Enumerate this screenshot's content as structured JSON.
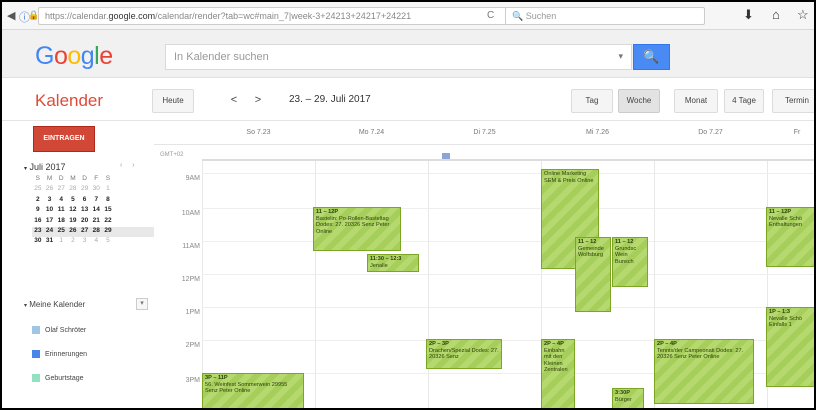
{
  "browser": {
    "url_prefix": "https://calendar.",
    "url_domain": "google.com",
    "url_rest": "/calendar/render?tab=wc#main_7|week-3+24213+24217+24221",
    "search_placeholder": "Suchen",
    "reload_glyph": "C",
    "icons": [
      "back-icon",
      "info-icon",
      "lock-icon",
      "reload-icon",
      "download-icon",
      "home-icon",
      "bookmark-icon"
    ]
  },
  "google": {
    "logo_letters": [
      "G",
      "o",
      "o",
      "g",
      "l",
      "e"
    ],
    "search_placeholder": "In Kalender suchen",
    "search_button_glyph": "🔍"
  },
  "toolbar": {
    "app_title": "Kalender",
    "today": "Heute",
    "prev": "<",
    "next": ">",
    "date_range": "23. – 29. Juli 2017",
    "views": [
      {
        "label": "Tag",
        "active": false
      },
      {
        "label": "Woche",
        "active": true
      },
      {
        "label": "Monat",
        "active": false
      },
      {
        "label": "4 Tage",
        "active": false
      },
      {
        "label": "Termin",
        "active": false
      }
    ]
  },
  "sidebar": {
    "create_button": "EINTRAGEN",
    "mini_title": "Juli 2017",
    "mini_nav": "‹ ›",
    "weekdays": [
      "S",
      "M",
      "D",
      "M",
      "D",
      "F",
      "S"
    ],
    "weeks": [
      [
        "25",
        "26",
        "27",
        "28",
        "29",
        "30",
        "1"
      ],
      [
        "2",
        "3",
        "4",
        "5",
        "6",
        "7",
        "8"
      ],
      [
        "9",
        "10",
        "11",
        "12",
        "13",
        "14",
        "15"
      ],
      [
        "16",
        "17",
        "18",
        "19",
        "20",
        "21",
        "22"
      ],
      [
        "23",
        "24",
        "25",
        "26",
        "27",
        "28",
        "29"
      ],
      [
        "30",
        "31",
        "1",
        "2",
        "3",
        "4",
        "5"
      ]
    ],
    "my_calendars_label": "Meine Kalender",
    "calendars": [
      {
        "name": "Olaf Schröter",
        "color": "#9fc6e7"
      },
      {
        "name": "Erinnerungen",
        "color": "#4986e7"
      },
      {
        "name": "Geburtstage",
        "color": "#92e1c0"
      }
    ]
  },
  "grid": {
    "gmt_label": "GMT+02",
    "days": [
      "So 7.23",
      "Mo 7.24",
      "Di 7.25",
      "Mi 7.26",
      "Do 7.27",
      "Fr"
    ],
    "hours": [
      "9AM",
      "10AM",
      "11AM",
      "12PM",
      "1PM",
      "2PM",
      "3PM"
    ],
    "events": [
      {
        "title": "",
        "text": "Online Marketing SEM & Preis Online"
      },
      {
        "title": "11 – 12P",
        "text": "Bastelin: Po-Rollen-Basteltag Dodes: 27. 20326 Senz Peter Online"
      },
      {
        "title": "11:30 – 12:3",
        "text": "Jenalle"
      },
      {
        "title": "11 – 12",
        "text": "Gemeinde Wolfsburg"
      },
      {
        "title": "11 – 12",
        "text": "Grundsc Wein Bunsch"
      },
      {
        "title": "11 – 12P",
        "text": "Nevalle Schö Enthaltungen"
      },
      {
        "title": "2P – 3P",
        "text": "Drachen/Spezial Dodes: 27. 20326 Senz"
      },
      {
        "title": "2P – 4P",
        "text": "Einbahn mit den Kleinen Zentralen"
      },
      {
        "title": "2P – 4P",
        "text": "Tennis/der Campeonati Dodes: 27. 20326 Senz Peter Online"
      },
      {
        "title": "1P – 1:3",
        "text": "Nevalle Schö Einfalls 1"
      },
      {
        "title": "3P – 11P",
        "text": "56. Weinfest Sommerwein 29955 Senz Peter Online"
      },
      {
        "title": "3:30P",
        "text": "Bürger"
      }
    ]
  }
}
